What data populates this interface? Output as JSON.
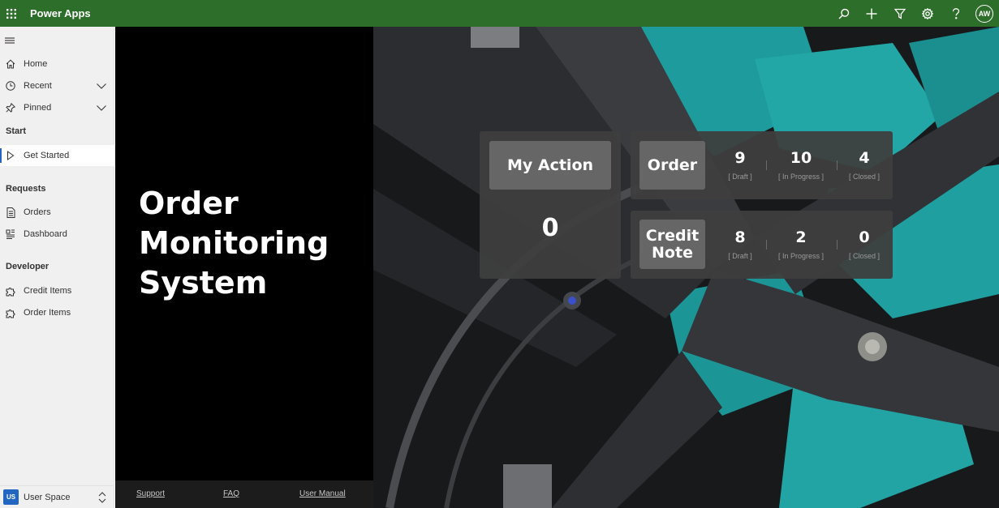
{
  "app": {
    "title": "Power Apps",
    "avatar": "AW"
  },
  "sidebar": {
    "items": {
      "home": "Home",
      "recent": "Recent",
      "pinned": "Pinned",
      "get_started": "Get Started",
      "orders": "Orders",
      "dashboard": "Dashboard",
      "credit_items": "Credit Items",
      "order_items": "Order Items"
    },
    "sections": {
      "start": "Start",
      "requests": "Requests",
      "developer": "Developer"
    },
    "user_space": {
      "badge": "US",
      "label": "User Space"
    }
  },
  "panel": {
    "title_line1": "Order",
    "title_line2": "Monitoring",
    "title_line3": "System",
    "footer": {
      "support": "Support",
      "faq": "FAQ",
      "manual": "User Manual"
    }
  },
  "dashboard": {
    "my_action": {
      "label": "My Action",
      "value": "0"
    },
    "order": {
      "label": "Order",
      "draft": {
        "value": "9",
        "label": "[ Draft ]"
      },
      "in_progress": {
        "value": "10",
        "label": "[ In Progress ]"
      },
      "closed": {
        "value": "4",
        "label": "[ Closed ]"
      }
    },
    "credit_note": {
      "label_line1": "Credit",
      "label_line2": "Note",
      "draft": {
        "value": "8",
        "label": "[ Draft ]"
      },
      "in_progress": {
        "value": "2",
        "label": "[ In Progress ]"
      },
      "closed": {
        "value": "0",
        "label": "[ Closed ]"
      }
    }
  },
  "colors": {
    "topbar": "#2d6e2a",
    "accent": "#2266c2",
    "card": "#3e3e3e",
    "teal": "#1fa9a9"
  },
  "icons": [
    "waffle-icon",
    "search-icon",
    "plus-icon",
    "filter-icon",
    "gear-icon",
    "help-icon",
    "hamburger-icon",
    "home-icon",
    "clock-icon",
    "pin-icon",
    "play-icon",
    "document-icon",
    "dashboard-icon",
    "puzzle-icon",
    "chevron-down-icon",
    "chevron-updown-icon"
  ]
}
